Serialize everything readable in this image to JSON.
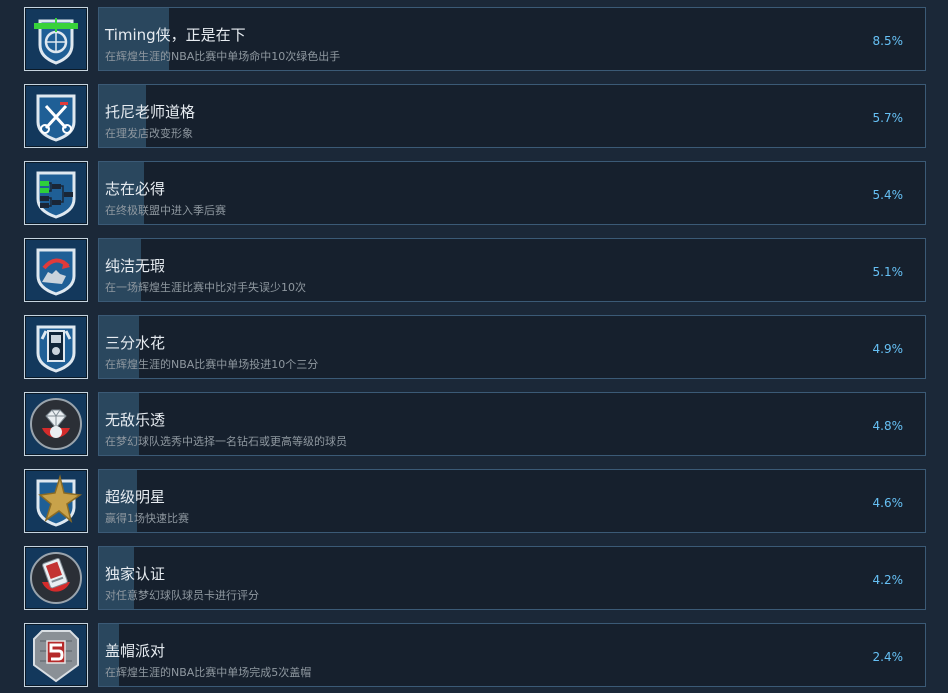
{
  "colors": {
    "background": "#1b2838",
    "panel_border": "#3b5a76",
    "progress_fill": "#2a475e",
    "title_text": "#e7ecf1",
    "desc_text": "#8f98a0",
    "percent_text": "#66c0f4"
  },
  "achievements": [
    {
      "title": "Timing侠，正是在下",
      "desc": "在辉煌生涯的NBA比赛中单场命中10次绿色出手",
      "percent": "8.5%",
      "fill": 0.085,
      "icon": "basketball-shield-icon"
    },
    {
      "title": "托尼老师道格",
      "desc": "在理发店改变形象",
      "percent": "5.7%",
      "fill": 0.057,
      "icon": "scissors-comb-icon"
    },
    {
      "title": "志在必得",
      "desc": "在终极联盟中进入季后赛",
      "percent": "5.4%",
      "fill": 0.054,
      "icon": "playoff-bracket-icon"
    },
    {
      "title": "纯洁无瑕",
      "desc": "在一场辉煌生涯比赛中比对手失误少10次",
      "percent": "5.1%",
      "fill": 0.051,
      "icon": "steal-hand-icon"
    },
    {
      "title": "三分水花",
      "desc": "在辉煌生涯的NBA比赛中单场投进10个三分",
      "percent": "4.9%",
      "fill": 0.049,
      "icon": "jersey-player-icon"
    },
    {
      "title": "无敌乐透",
      "desc": "在梦幻球队选秀中选择一名钻石或更高等级的球员",
      "percent": "4.8%",
      "fill": 0.048,
      "icon": "diamond-card-icon"
    },
    {
      "title": "超级明星",
      "desc": "赢得1场快速比赛",
      "percent": "4.6%",
      "fill": 0.046,
      "icon": "gold-star-icon"
    },
    {
      "title": "独家认证",
      "desc": "对任意梦幻球队球员卡进行评分",
      "percent": "4.2%",
      "fill": 0.042,
      "icon": "player-card-icon"
    },
    {
      "title": "盖帽派对",
      "desc": "在辉煌生涯的NBA比赛中单场完成5次盖帽",
      "percent": "2.4%",
      "fill": 0.024,
      "icon": "block-five-icon"
    }
  ]
}
